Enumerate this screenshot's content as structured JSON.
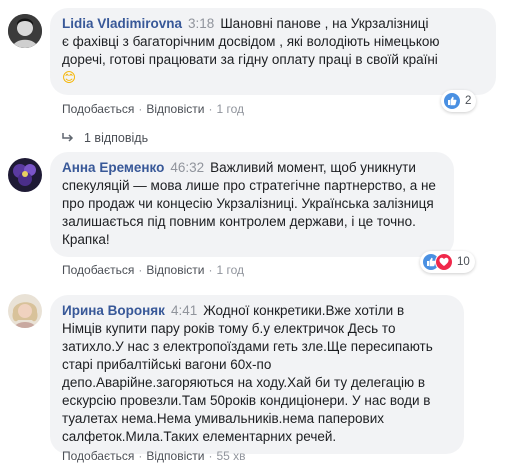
{
  "comments": [
    {
      "author": "Lidia Vladimirovna",
      "time": "3:18",
      "lines": [
        "Шановні панове , на Укрзалізниці",
        "є фахівці з багаторічним досвідом , які володіють німецькою",
        "доречі, готові працювати за гідну оплату праці в своїй країні"
      ],
      "emoji": "😊",
      "like_label": "Подобається",
      "reply_label": "Відповісти",
      "age": "1 год",
      "reaction_count": "2",
      "reactions": [
        "like-icon"
      ]
    },
    {
      "author": "Анна Еременко",
      "time": "46:32",
      "lines": [
        "Важливий момент, щоб уникнути",
        "спекуляцій — мова лише про стратегічне партнерство, а не",
        "про продаж чи концесію Укрзалізниці. Українська залізниця",
        "залишається під повним контролем держави, і це точно.",
        "Крапка!"
      ],
      "like_label": "Подобається",
      "reply_label": "Відповісти",
      "age": "1 год",
      "reaction_count": "10",
      "reactions": [
        "like-icon",
        "love-icon"
      ]
    },
    {
      "author": "Ирина Вороняк",
      "time": "4:41",
      "lines": [
        "Жодної конкретики.Вже хотіли в",
        "Німців купити пару років тому б.у електричок Десь то",
        "затихло.У нас з електропоїздами геть зле.Ще пересипають",
        "старі прибалтійські вагони 60х-по",
        "депо.Аварійне.загоряються на ходу.Хай би ту делегацію в",
        "ескурсію провезли.Там 50років кондиціонери. У нас води в",
        "туалетах нема.Нема умивальників.нема паперових",
        "салфеток.Мила.Таких елементарних речей."
      ],
      "like_label": "Подобається",
      "reply_label": "Відповісти",
      "age": "55 хв"
    }
  ],
  "replies_link": "1 відповідь",
  "colors": {
    "author": "#385898",
    "bubble": "#f2f3f5",
    "meta": "#90949c",
    "like": "#4a90e2",
    "love": "#f0284a"
  }
}
